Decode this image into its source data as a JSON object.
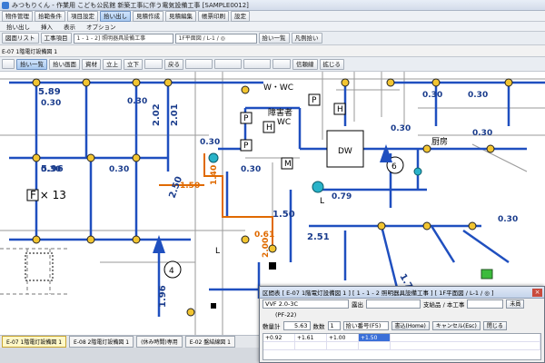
{
  "window": {
    "title": "みつもりくん - 作業用 こども公民館 新築工事に伴う電気設備工事 [SAMPLE0012]"
  },
  "toolbar1": {
    "buttons": [
      "物件管理",
      "拾範条件",
      "項目設定",
      "拾い出し",
      "見積作成",
      "見積編集",
      "帳票印刷",
      "設定"
    ],
    "active_index": 3
  },
  "menu": {
    "items": [
      "拾い出し",
      "挿入",
      "表示",
      "オプション"
    ]
  },
  "toolbar3": {
    "list_button": "図面リスト",
    "item_label": "工事項目",
    "item_combo": "1 - 1 - 2] 照明器具設備工事",
    "floor_combo": "1F平面図 / L-1 / ◎",
    "pick_button": "拾い一覧",
    "legend_button": "凡例拾い"
  },
  "doc_tab": "E-07 1階電灯設備図 1",
  "toolbar5": {
    "buttons": [
      "拾い一覧",
      "拾い画面",
      "資材",
      "立上",
      "立下",
      "",
      "戻る",
      "",
      "",
      "",
      "",
      "信頼線",
      "拡じる"
    ]
  },
  "drawing": {
    "measurements": [
      "5.89",
      "0.30",
      "2.02",
      "2.01",
      "0.30",
      "0.30",
      "5.96",
      "0.30",
      "1.50",
      "2.50",
      "1.40",
      "0.30",
      "0.79",
      "1.50",
      "2.51",
      "0.30",
      "0.61",
      "2.00",
      "1.96",
      "1.75",
      "0.30",
      "0.30",
      "0.30",
      "0.30",
      "0.30"
    ],
    "room_labels": [
      "W・WC",
      "障害者",
      "WC",
      "DW",
      "厨房",
      "L",
      "L"
    ],
    "fixture_label": "F × 13",
    "circle_numbers": [
      "6",
      "4"
    ],
    "letters": [
      "P",
      "H",
      "P",
      "H",
      "P",
      "M"
    ]
  },
  "status_tabs": [
    "E-07 1階電灯設備図 1",
    "E-08 2階電灯設備図 1",
    "(休み時間)専用",
    "E-02 盤結線図 1"
  ],
  "dialog": {
    "title": "区間表 [ E-07 1階電灯設備図 1 ] [ 1 - 1 - 2 照明器具設備工事 ] [ 1F平面図 / L-1 / ◎ ]",
    "cable_label": "VVF 2.0-3C",
    "cable_sub": "(PF-22)",
    "location_label": "露出",
    "support_label": "支給品 / 本工事",
    "unit_label": "未員",
    "total_label": "敷量計",
    "total_value": "5.63",
    "count_label": "数数",
    "count_value": "1",
    "mode_label": "拾い番号(F5)",
    "buttons": [
      "書込(Home)",
      "キャンセル(Esc)",
      "閉じる"
    ],
    "grid": [
      [
        "+0.92",
        "+1.61",
        "+1.00",
        "+1.50"
      ]
    ]
  }
}
